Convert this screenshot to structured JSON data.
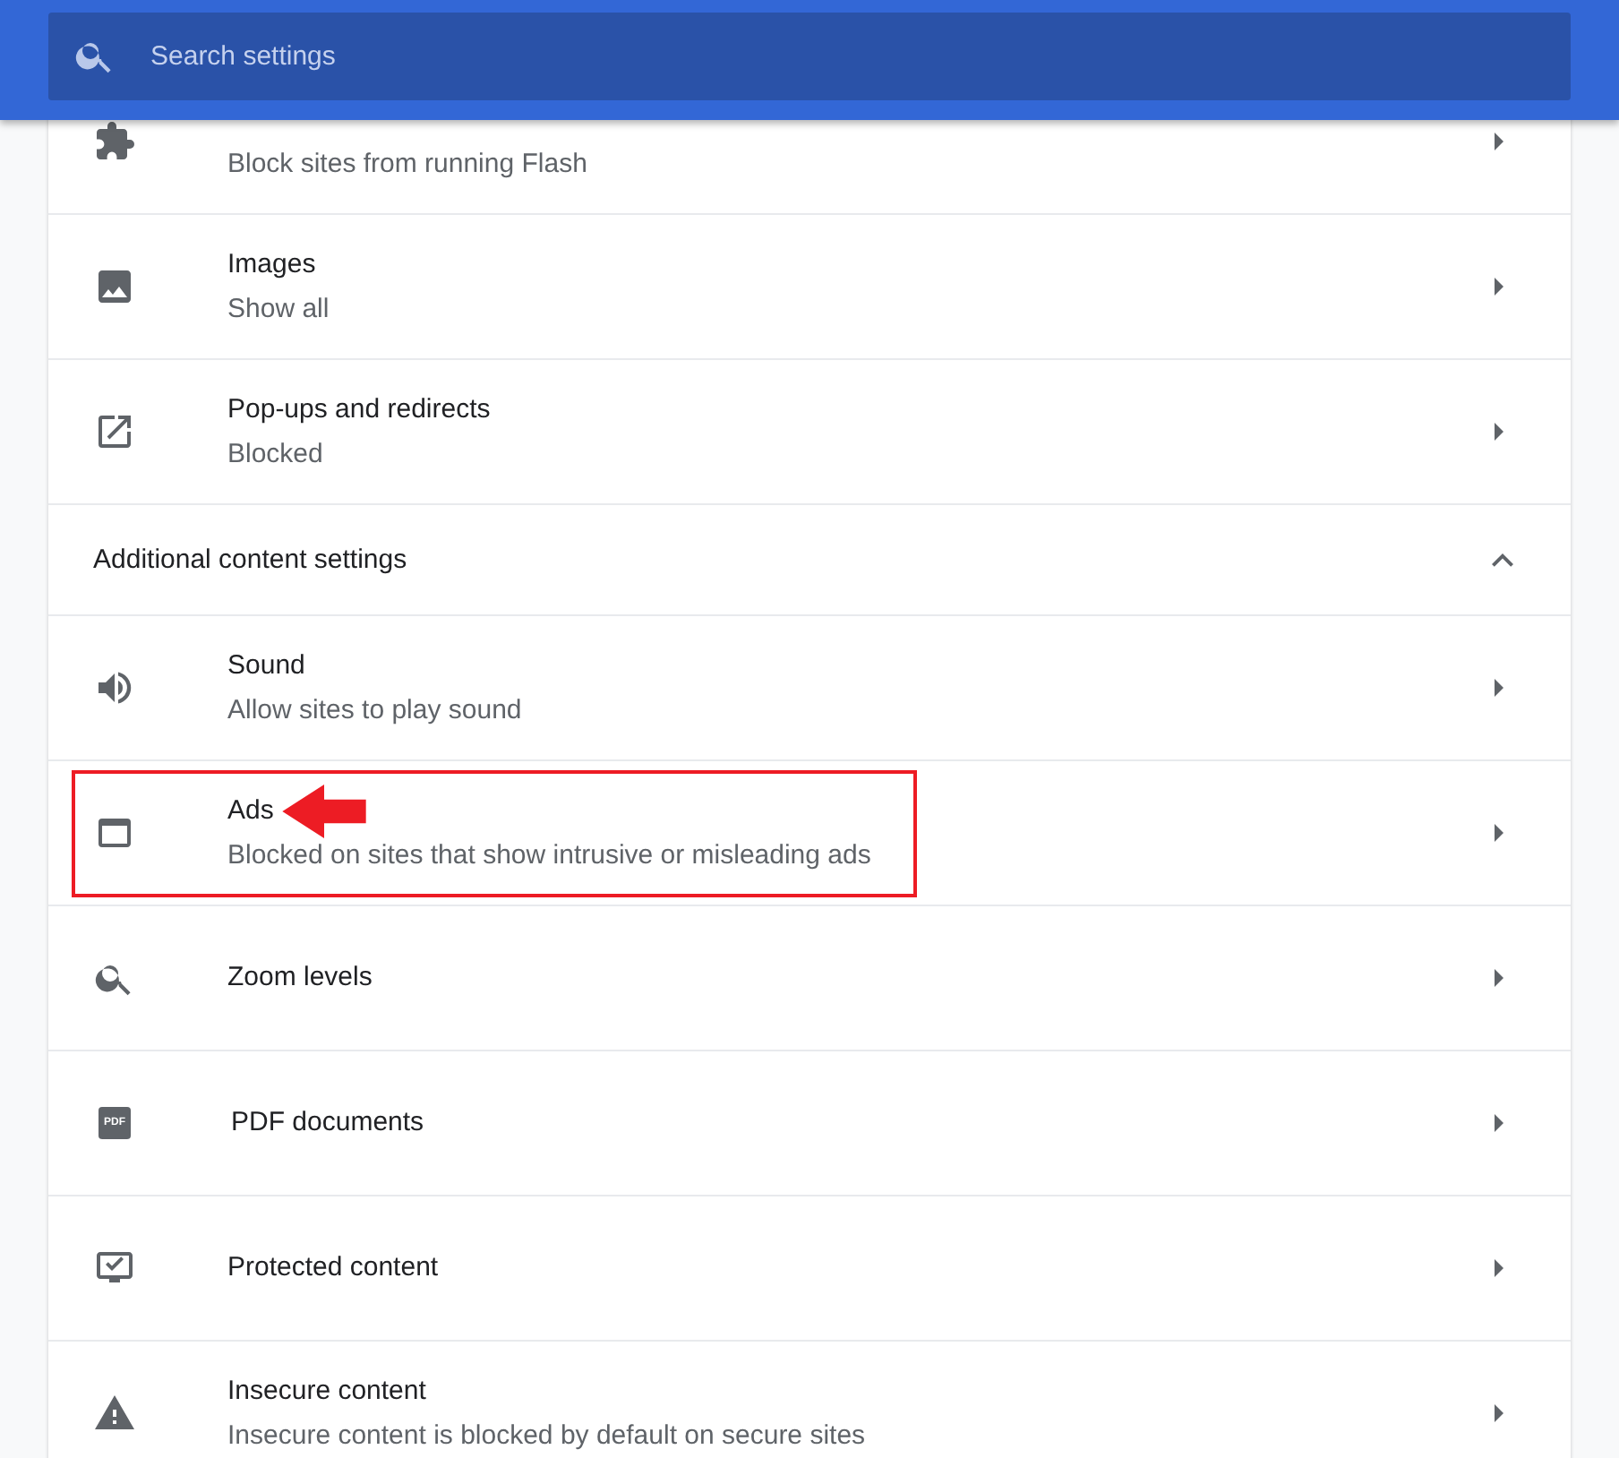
{
  "search": {
    "placeholder": "Search settings"
  },
  "rows": [
    {
      "kind": "setting",
      "subtitle": "Block sites from running Flash",
      "highlighted": false
    },
    {
      "kind": "setting",
      "title": "Images",
      "subtitle": "Show all",
      "highlighted": false
    },
    {
      "kind": "setting",
      "title": "Pop-ups and redirects",
      "subtitle": "Blocked",
      "highlighted": false
    },
    {
      "kind": "section",
      "title": "Additional content settings",
      "expanded": true
    },
    {
      "kind": "setting",
      "title": "Sound",
      "subtitle": "Allow sites to play sound",
      "highlighted": false
    },
    {
      "kind": "setting",
      "title": "Ads",
      "subtitle": "Blocked on sites that show intrusive or misleading ads",
      "highlighted": true
    },
    {
      "kind": "setting",
      "title": "Zoom levels",
      "highlighted": false
    },
    {
      "kind": "setting",
      "icon_text": "PDF",
      "title": "PDF documents",
      "highlighted": false
    },
    {
      "kind": "setting",
      "title": "Protected content",
      "highlighted": false
    },
    {
      "kind": "setting",
      "title": "Insecure content",
      "subtitle": "Insecure content is blocked by default on secure sites",
      "highlighted": false
    }
  ]
}
